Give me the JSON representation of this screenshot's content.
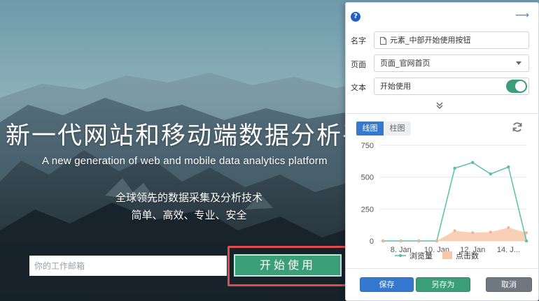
{
  "hero": {
    "headline": "新一代网站和移动端数据分析平台",
    "subline": "A new generation of web and mobile data analytics platform",
    "slogan_line1": "全球领先的数据采集及分析技术",
    "slogan_line2": "简单、高效、专业、安全",
    "email_placeholder": "你的工作邮箱",
    "start_button": "开始使用"
  },
  "panel": {
    "help_icon": "?",
    "icons": [
      "help-icon",
      "arrow-right-icon",
      "document-icon",
      "chevron-down-icon",
      "double-chevron-down-icon",
      "refresh-icon"
    ],
    "fields": {
      "name_label": "名字",
      "name_value": "元素_中部开始使用按钮",
      "page_label": "页面",
      "page_value": "页面_官网首页",
      "text_label": "文本",
      "text_value": "开始使用",
      "text_toggle_on": true
    },
    "tabs": {
      "line": "线图",
      "bar": "柱图",
      "active": "line"
    },
    "buttons": {
      "save": "保存",
      "save_as": "另存为",
      "cancel": "取消"
    }
  },
  "colors": {
    "accent_blue": "#3478d0",
    "accent_green": "#3a9e78",
    "highlight_red": "#e04c4c",
    "series_views": "#5bbfa6",
    "series_clicks": "#f6c8a8"
  },
  "chart_data": {
    "type": "line",
    "x_ticks": [
      "8. Jan",
      "10. Jan",
      "12. Jan",
      "14. J..."
    ],
    "x_tick_positions": [
      8,
      10,
      12,
      14
    ],
    "y_ticks": [
      "0",
      "250",
      "500",
      "750"
    ],
    "ylim": [
      0,
      750
    ],
    "xlim": [
      6.8,
      15
    ],
    "grid": true,
    "legend_placement": "bottom",
    "series": [
      {
        "name": "浏览量",
        "kind": "line",
        "x": [
          7,
          8,
          9,
          10,
          11,
          12,
          13,
          14,
          15
        ],
        "values": [
          0,
          0,
          0,
          0,
          570,
          615,
          525,
          580,
          0
        ]
      },
      {
        "name": "点击数",
        "kind": "area",
        "x": [
          7,
          8,
          9,
          10,
          11,
          12,
          13,
          14,
          15
        ],
        "values": [
          0,
          0,
          0,
          0,
          80,
          65,
          70,
          105,
          65
        ]
      }
    ]
  }
}
